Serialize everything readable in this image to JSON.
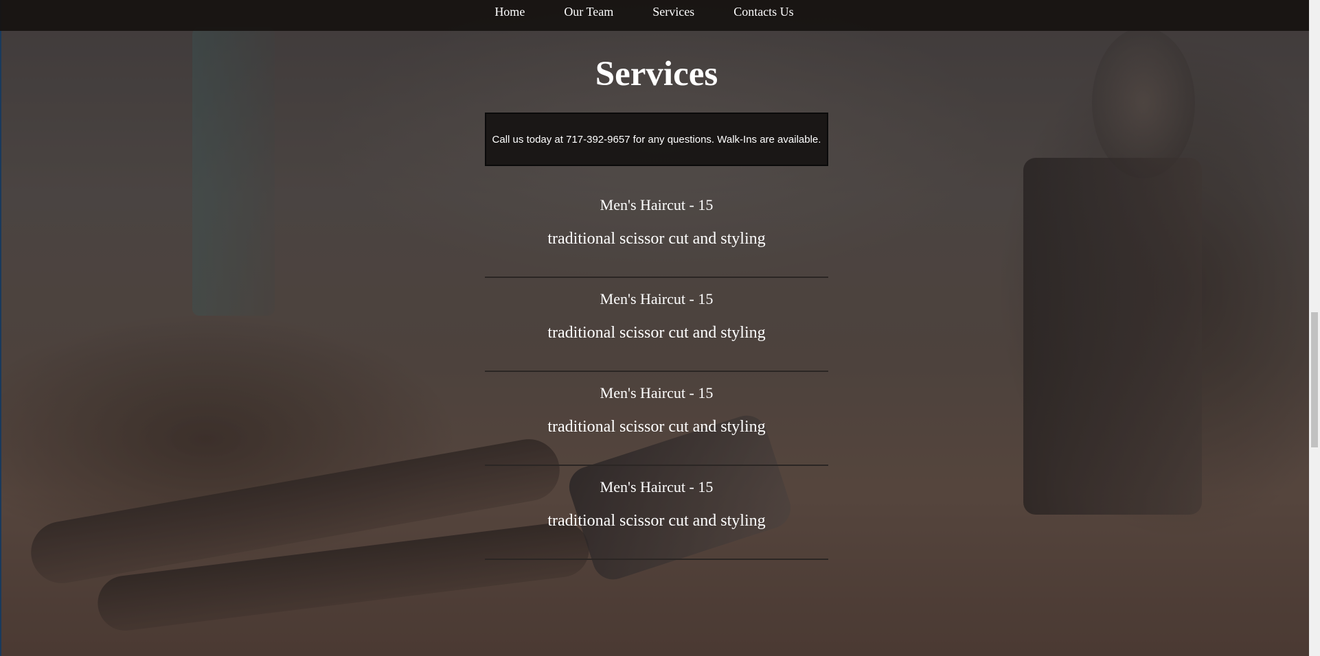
{
  "nav": {
    "items": [
      {
        "label": "Home"
      },
      {
        "label": "Our Team"
      },
      {
        "label": "Services"
      },
      {
        "label": "Contacts Us"
      }
    ]
  },
  "main": {
    "title": "Services",
    "notice": "Call us today at 717-392-9657 for any questions. Walk-Ins are available.",
    "services": [
      {
        "name": "Men's Haircut - 15",
        "description": "traditional scissor cut and styling"
      },
      {
        "name": "Men's Haircut - 15",
        "description": "traditional scissor cut and styling"
      },
      {
        "name": "Men's Haircut - 15",
        "description": "traditional scissor cut and styling"
      },
      {
        "name": "Men's Haircut - 15",
        "description": "traditional scissor cut and styling"
      }
    ]
  },
  "colors": {
    "nav_bg": "#161210",
    "text": "#ffffff",
    "divider": "#2b2624",
    "notice_bg": "#161412"
  },
  "icons": {
    "background": "barber-tools-photo"
  }
}
